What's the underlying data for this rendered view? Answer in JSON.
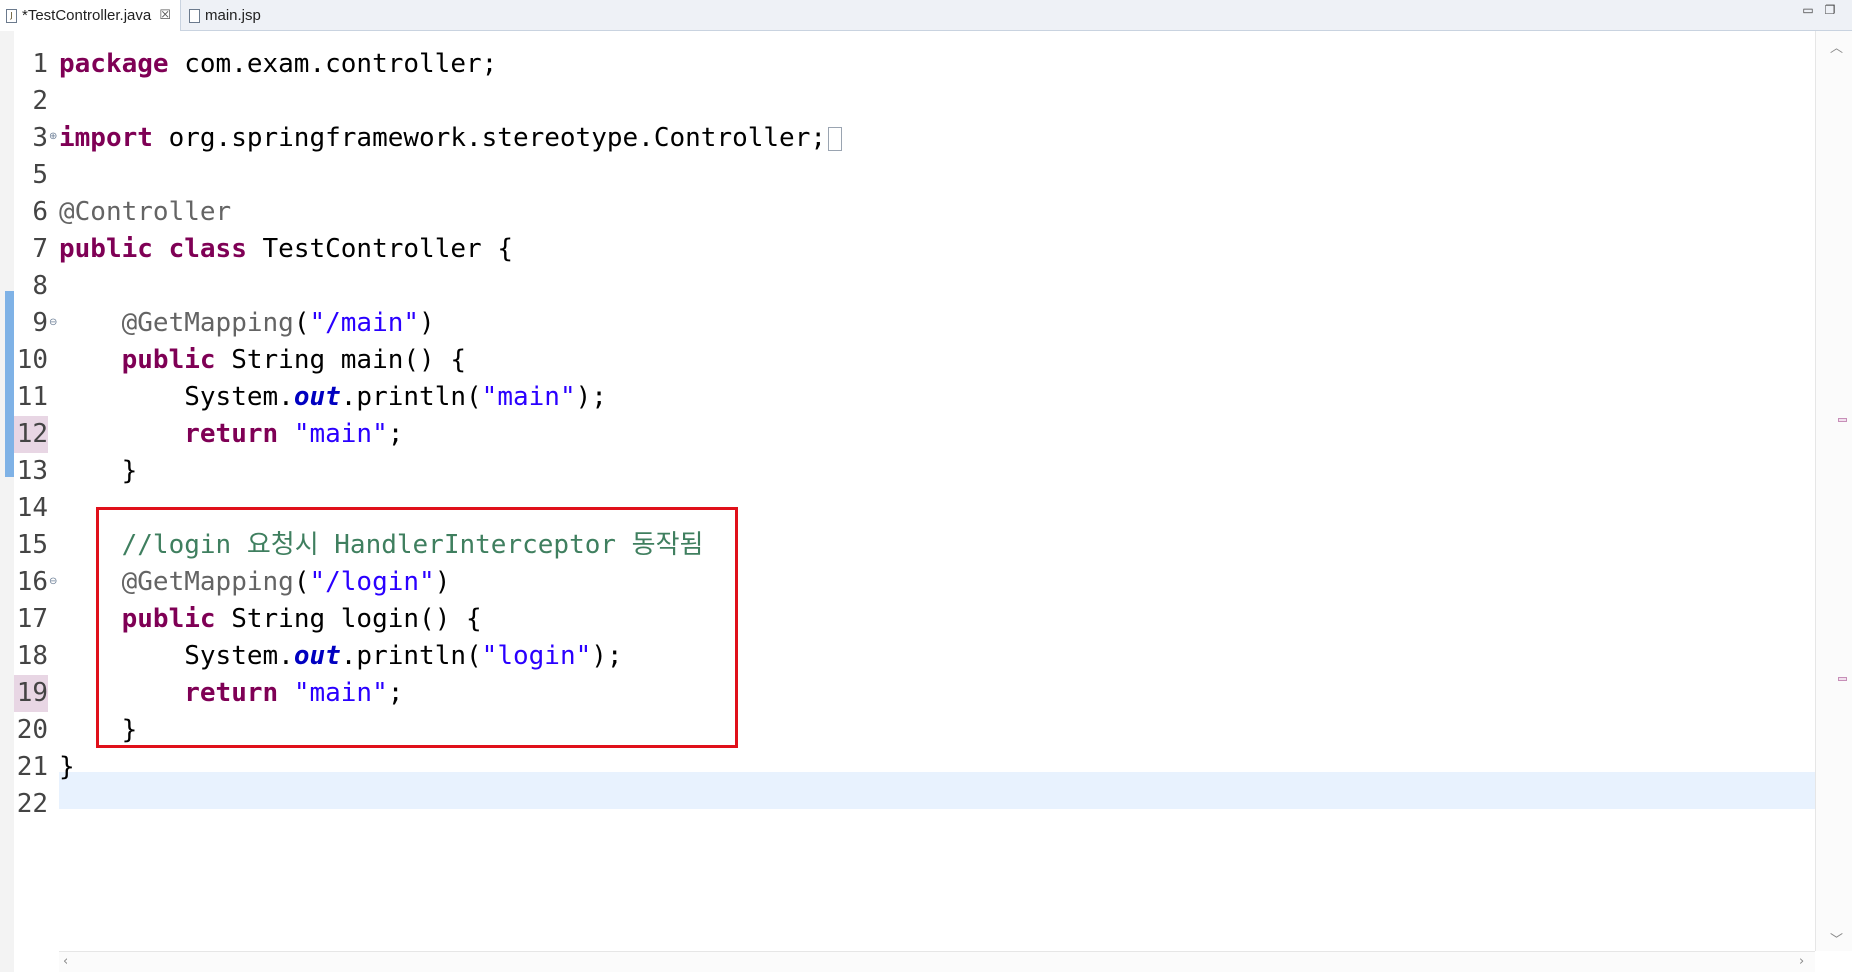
{
  "tabs": [
    {
      "label": "*TestController.java",
      "icon": "java-file-icon",
      "active": true
    },
    {
      "label": "main.jsp",
      "icon": "jsp-file-icon",
      "active": false
    }
  ],
  "window_controls": {
    "minimize": "▭",
    "restore": "❐"
  },
  "close_glyph": "☒",
  "line_numbers": [
    "1",
    "2",
    "3",
    "5",
    "6",
    "7",
    "8",
    "9",
    "10",
    "11",
    "12",
    "13",
    "14",
    "15",
    "16",
    "17",
    "18",
    "19",
    "20",
    "21",
    "22"
  ],
  "code": {
    "l1": {
      "kw": "package",
      "rest": " com.exam.controller;"
    },
    "l3": {
      "kw": "import",
      "rest": " org.springframework.stereotype.Controller;"
    },
    "l6": {
      "ann": "@Controller"
    },
    "l7": {
      "kw1": "public",
      "kw2": "class",
      "rest": " TestController {"
    },
    "l9": {
      "ann": "@GetMapping",
      "open": "(",
      "str": "\"/main\"",
      "close": ")"
    },
    "l10": {
      "kw": "public",
      "rest": " String main() {"
    },
    "l11": {
      "pre": "System.",
      "field": "out",
      "mid": ".println(",
      "str": "\"main\"",
      "post": ");"
    },
    "l12": {
      "kw": "return",
      "str": "\"main\"",
      "post": ";"
    },
    "l13": {
      "text": "}"
    },
    "l15": {
      "comment": "//login 요청시 HandlerInterceptor 동작됨"
    },
    "l16": {
      "ann": "@GetMapping",
      "open": "(",
      "str": "\"/login\"",
      "close": ")"
    },
    "l17": {
      "kw": "public",
      "rest": " String login() {"
    },
    "l18": {
      "pre": "System.",
      "field": "out",
      "mid": ".println(",
      "str": "\"login\"",
      "post": ");"
    },
    "l19": {
      "kw": "return",
      "str": "\"main\"",
      "post": ";"
    },
    "l20": {
      "text": "}"
    },
    "l21": {
      "text": "}"
    }
  },
  "colors": {
    "keyword": "#7f0055",
    "string": "#2a00ff",
    "annotation": "#646464",
    "comment": "#3f7f5f",
    "highlight_box": "#e0101a",
    "current_line": "#e8f2fe"
  }
}
